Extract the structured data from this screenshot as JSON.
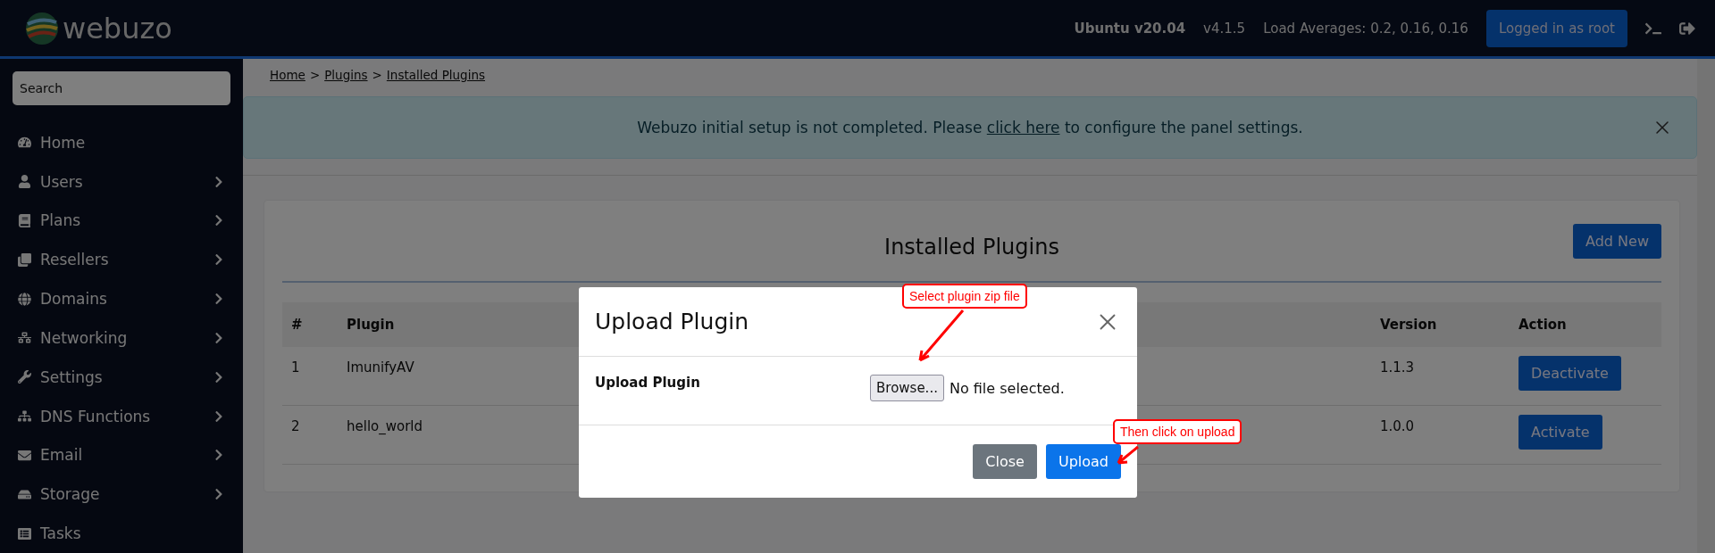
{
  "header": {
    "logo": "webuzo",
    "os": "Ubuntu v20.04",
    "version": "v4.1.5",
    "load": "Load Averages: 0.2, 0.16, 0.16",
    "user_button": "Logged in as root"
  },
  "sidebar": {
    "search": {
      "placeholder": "Search"
    },
    "items": [
      {
        "label": "Home",
        "has_submenu": false
      },
      {
        "label": "Users",
        "has_submenu": true
      },
      {
        "label": "Plans",
        "has_submenu": true
      },
      {
        "label": "Resellers",
        "has_submenu": true
      },
      {
        "label": "Domains",
        "has_submenu": true
      },
      {
        "label": "Networking",
        "has_submenu": true
      },
      {
        "label": "Settings",
        "has_submenu": true
      },
      {
        "label": "DNS Functions",
        "has_submenu": true
      },
      {
        "label": "Email",
        "has_submenu": true
      },
      {
        "label": "Storage",
        "has_submenu": true
      },
      {
        "label": "Tasks",
        "has_submenu": false
      }
    ]
  },
  "breadcrumb": [
    "Home",
    "Plugins",
    "Installed Plugins"
  ],
  "breadcrumb_separator": ">",
  "alert": {
    "before": "Webuzo initial setup is not completed. Please ",
    "link": "click here",
    "after": " to configure the panel settings."
  },
  "card": {
    "title": "Installed Plugins",
    "add_button": "Add New",
    "table": {
      "columns": [
        "#",
        "Plugin",
        "Version",
        "Action"
      ],
      "rows": [
        {
          "number": "1",
          "plugin": "ImunifyAV",
          "version": "1.1.3",
          "action": "Deactivate"
        },
        {
          "number": "2",
          "plugin": "hello_world",
          "version": "1.0.0",
          "action": "Activate"
        }
      ]
    }
  },
  "modal": {
    "title": "Upload Plugin",
    "field_label": "Upload Plugin",
    "browse_button": "Browse...",
    "file_status": "No file selected.",
    "buttons": [
      {
        "label": "Close",
        "kind": "secondary"
      },
      {
        "label": "Upload",
        "kind": "primary"
      }
    ]
  },
  "annotations": [
    {
      "text": "Select plugin zip file"
    },
    {
      "text": "Then click on upload"
    }
  ]
}
